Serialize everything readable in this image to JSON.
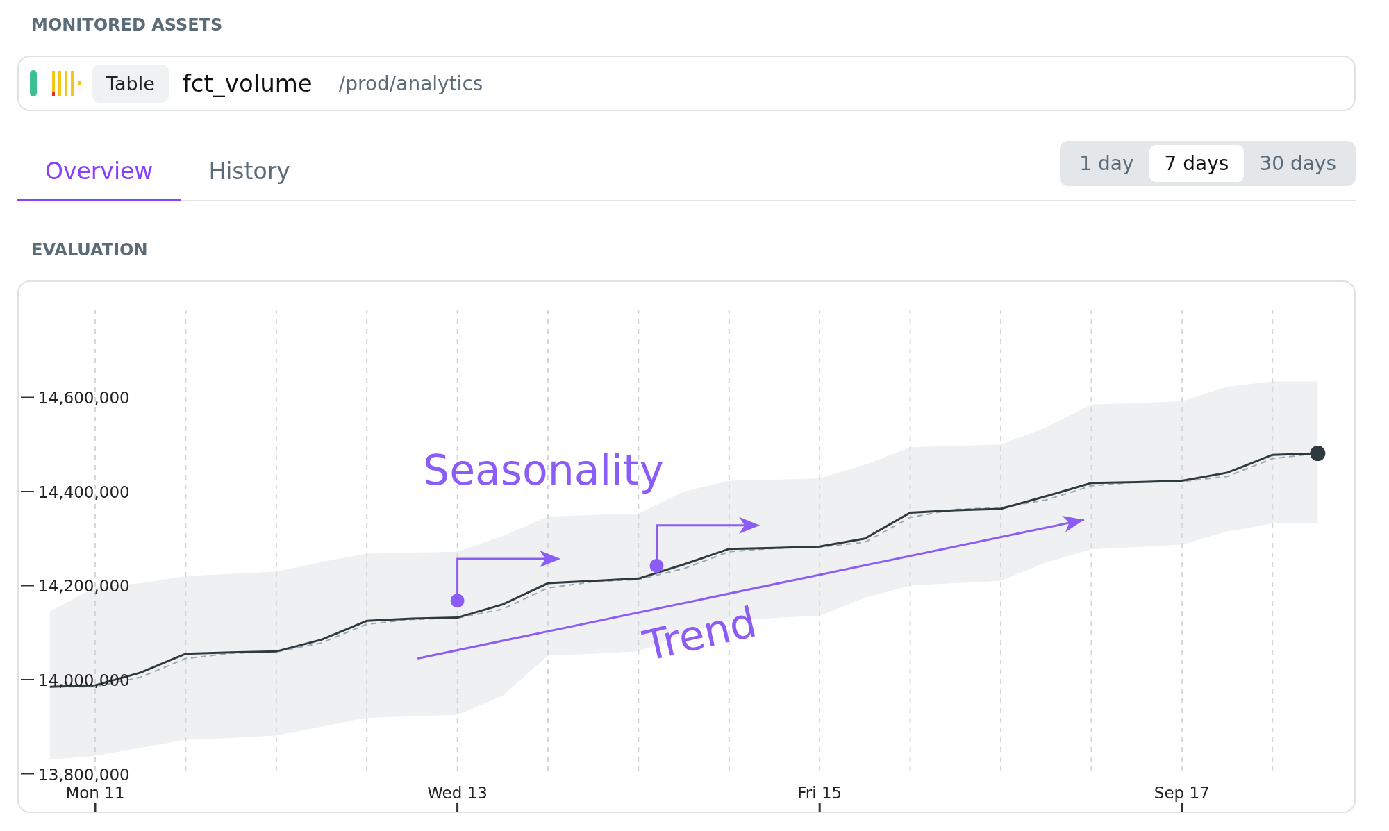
{
  "section_title": "MONITORED ASSETS",
  "asset": {
    "type": "Table",
    "name": "fct_volume",
    "path": "/prod/analytics"
  },
  "tabs": [
    {
      "label": "Overview",
      "selected": true
    },
    {
      "label": "History",
      "selected": false
    }
  ],
  "ranges": [
    {
      "label": "1 day",
      "selected": false
    },
    {
      "label": "7 days",
      "selected": true
    },
    {
      "label": "30 days",
      "selected": false
    }
  ],
  "evaluation": {
    "title": "EVALUATION",
    "chart_data": {
      "type": "line",
      "categories": [
        null,
        "Mon 11",
        null,
        null,
        null,
        null,
        null,
        null,
        null,
        "Wed 13",
        null,
        null,
        null,
        null,
        null,
        null,
        null,
        "Fri 15",
        null,
        null,
        null,
        null,
        null,
        null,
        null,
        "Sep 17",
        null,
        null,
        null
      ],
      "series": [
        {
          "color": "#9aa8b0",
          "line_style": "dashed",
          "values": [
            13985000,
            13985000,
            14005000,
            14045000,
            14056000,
            14059000,
            14078000,
            14118000,
            14128000,
            14131000,
            14150000,
            14195000,
            14208000,
            14213000,
            14236000,
            14272000,
            14279000,
            14282000,
            14292000,
            14345000,
            14362000,
            14366000,
            14382000,
            14412000,
            14420000,
            14421000,
            14432000,
            14470000,
            14481000
          ]
        },
        {
          "color": "#2f3a3f",
          "line_style": "solid",
          "values": [
            13985000,
            13988000,
            14015000,
            14055000,
            14058000,
            14060000,
            14085000,
            14125000,
            14130000,
            14132000,
            14160000,
            14205000,
            14210000,
            14215000,
            14245000,
            14278000,
            14280000,
            14283000,
            14300000,
            14355000,
            14360000,
            14363000,
            14390000,
            14418000,
            14420000,
            14423000,
            14440000,
            14478000,
            14481000
          ]
        }
      ],
      "grid": true,
      "ylim": [
        13800000,
        14845000
      ],
      "yticks": [
        {
          "value": 13800000,
          "label": "13,800,000"
        },
        {
          "value": 14000000,
          "label": "14,000,000"
        },
        {
          "value": 14200000,
          "label": "14,200,000"
        },
        {
          "value": 14400000,
          "label": "14,400,000"
        },
        {
          "value": 14600000,
          "label": "14,600,000"
        }
      ],
      "annotations": [
        "Seasonality",
        "Trend"
      ]
    }
  }
}
